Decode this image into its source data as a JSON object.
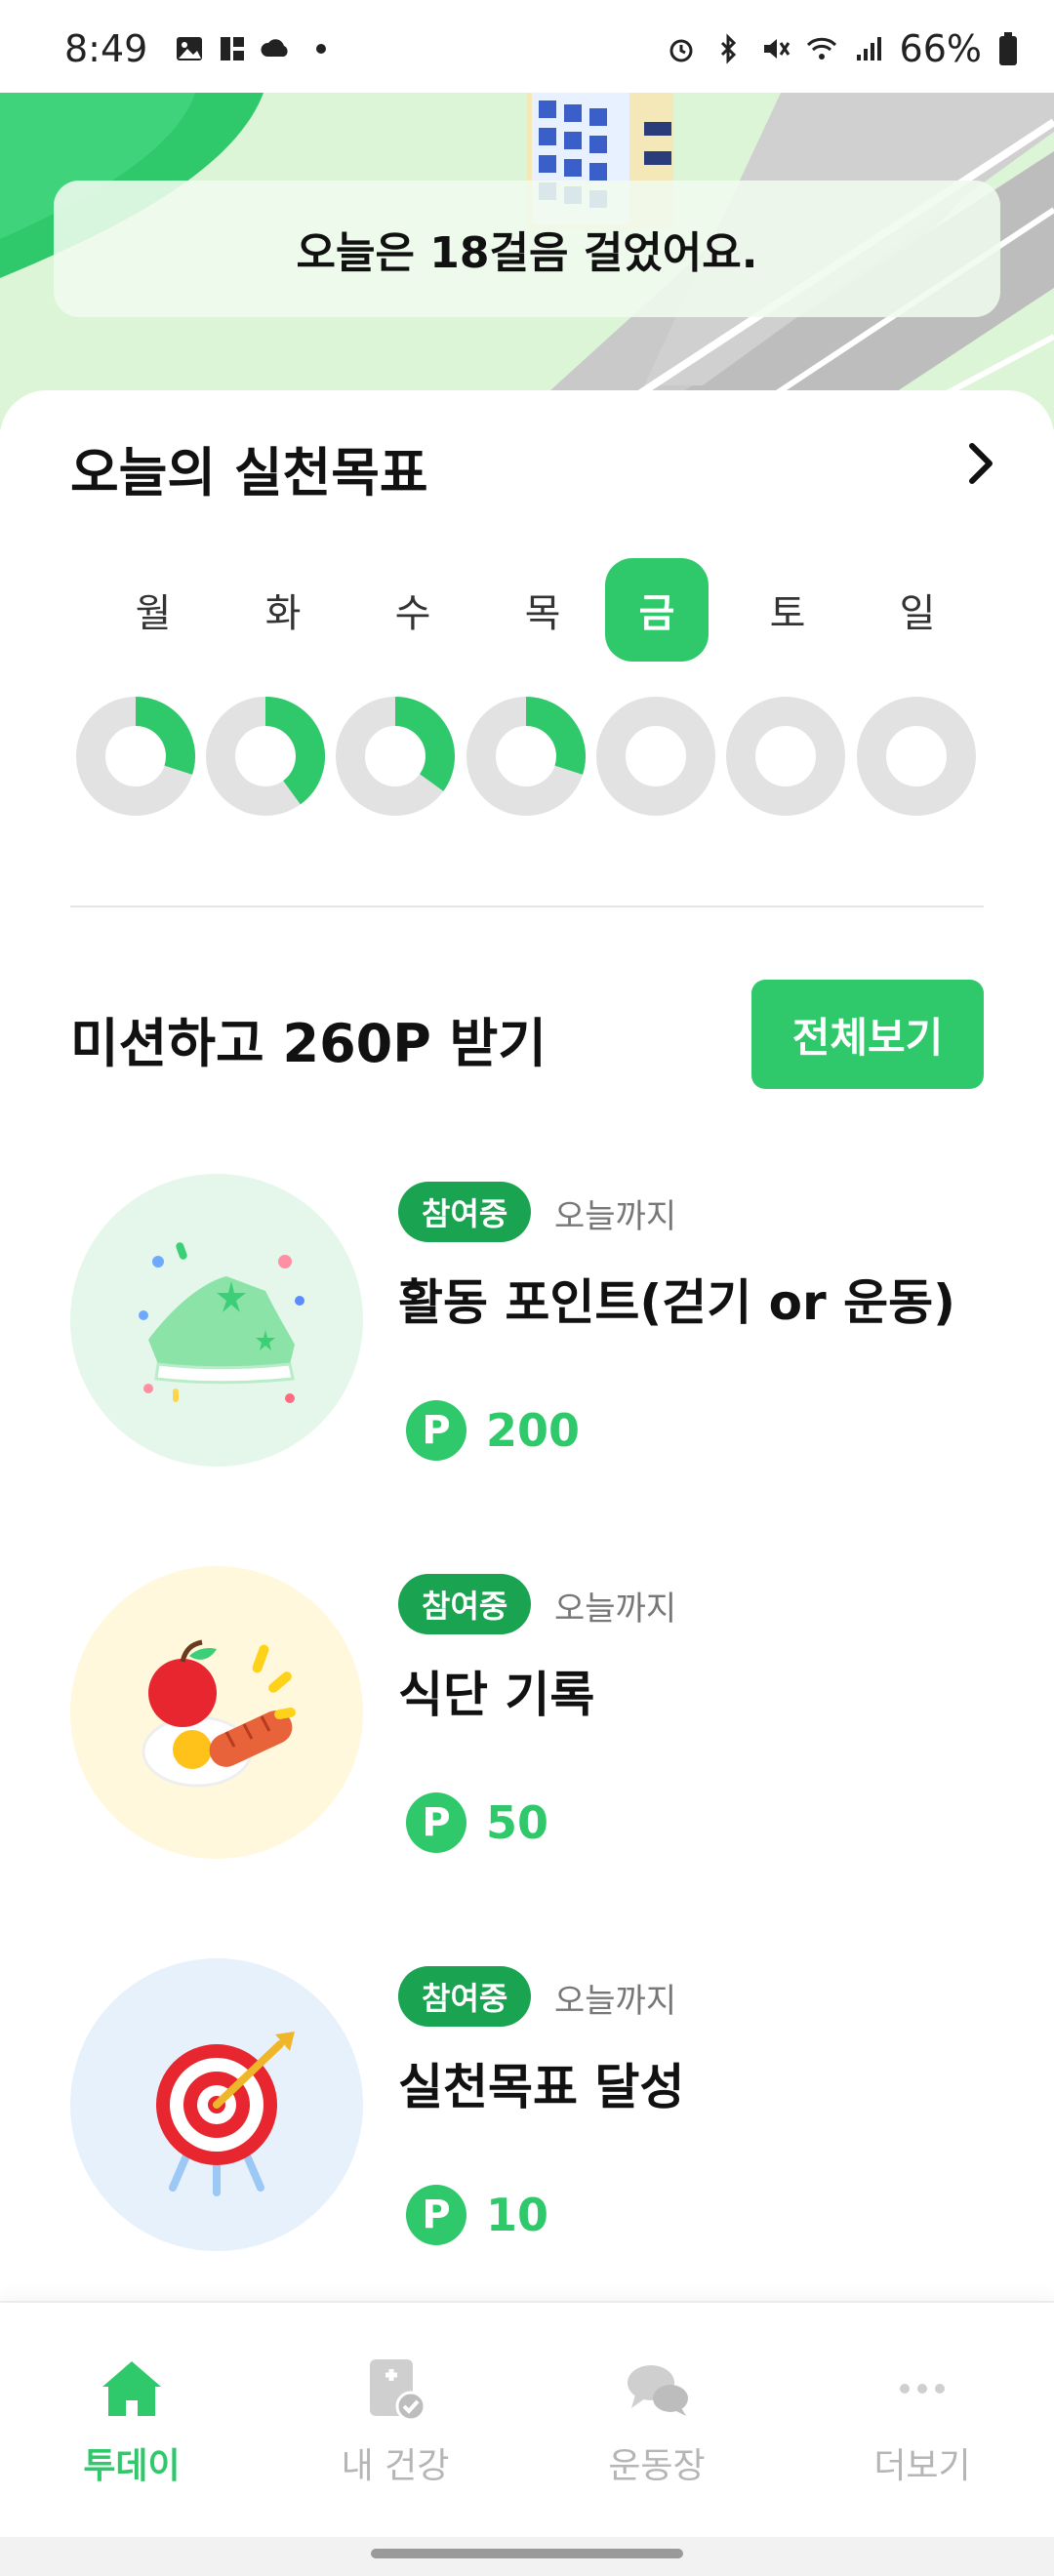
{
  "status_bar": {
    "time": "8:49",
    "battery": "66%"
  },
  "hero": {
    "banner_text": "오늘은 18걸음 걸었어요."
  },
  "goals": {
    "title": "오늘의 실천목표",
    "days": [
      "월",
      "화",
      "수",
      "목",
      "금",
      "토",
      "일"
    ],
    "active_day_index": 4,
    "progress": [
      0.3,
      0.4,
      0.35,
      0.3,
      0,
      0,
      0
    ]
  },
  "missions": {
    "title": "미션하고 260P 받기",
    "view_all": "전체보기",
    "items": [
      {
        "status": "참여중",
        "until": "오늘까지",
        "name": "활동 포인트(걷기 or 운동)",
        "points": "200",
        "icon": "sneaker-icon",
        "bg": "#e4f7ea"
      },
      {
        "status": "참여중",
        "until": "오늘까지",
        "name": "식단 기록",
        "points": "50",
        "icon": "meal-icon",
        "bg": "#fff8dc"
      },
      {
        "status": "참여중",
        "until": "오늘까지",
        "name": "실천목표 달성",
        "points": "10",
        "icon": "target-icon",
        "bg": "#e6f1fb"
      }
    ],
    "point_symbol": "P"
  },
  "bottom_nav": {
    "items": [
      {
        "label": "투데이",
        "icon": "home-icon",
        "active": true
      },
      {
        "label": "내 건강",
        "icon": "health-record-icon",
        "active": false
      },
      {
        "label": "운동장",
        "icon": "chat-bubbles-icon",
        "active": false
      },
      {
        "label": "더보기",
        "icon": "more-dots-icon",
        "active": false
      }
    ]
  },
  "colors": {
    "accent": "#2fc96b",
    "pill": "#1aa350",
    "ring_track": "#e2e2e2"
  }
}
